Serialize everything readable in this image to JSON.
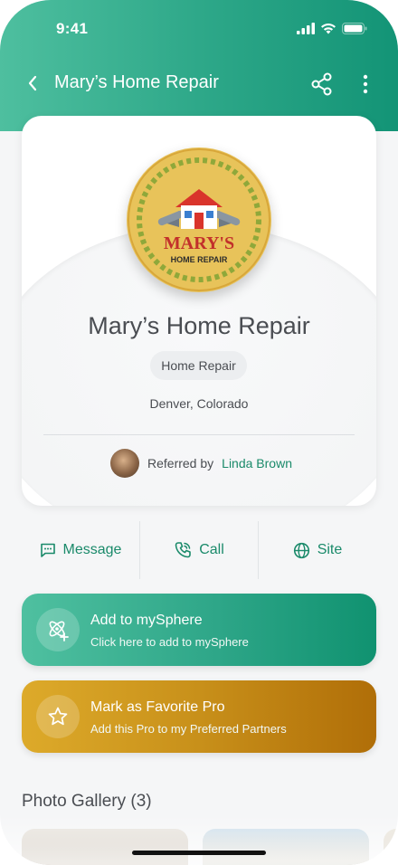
{
  "status_bar": {
    "time": "9:41"
  },
  "nav": {
    "title": "Mary’s Home Repair"
  },
  "profile": {
    "logo_text_top": "MARY'S",
    "logo_text_bottom": "HOME REPAIR",
    "name": "Mary’s Home Repair",
    "category": "Home Repair",
    "location": "Denver, Colorado",
    "referral_prefix": "Referred by",
    "referrer": "Linda Brown"
  },
  "actions": [
    {
      "label": "Message",
      "icon": "message-icon"
    },
    {
      "label": "Call",
      "icon": "phone-icon"
    },
    {
      "label": "Site",
      "icon": "globe-icon"
    }
  ],
  "cta": {
    "sphere": {
      "title": "Add to mySphere",
      "subtitle": "Click here to add to mySphere",
      "color": "#2ea688"
    },
    "favorite": {
      "title": "Mark as Favorite Pro",
      "subtitle": "Add this Pro to my Preferred Partners",
      "color": "#c8901a"
    }
  },
  "gallery": {
    "title": "Photo Gallery (3)"
  },
  "colors": {
    "brand": "#2ea889",
    "accent_text": "#1a8a6a",
    "favorite": "#c8901a"
  }
}
